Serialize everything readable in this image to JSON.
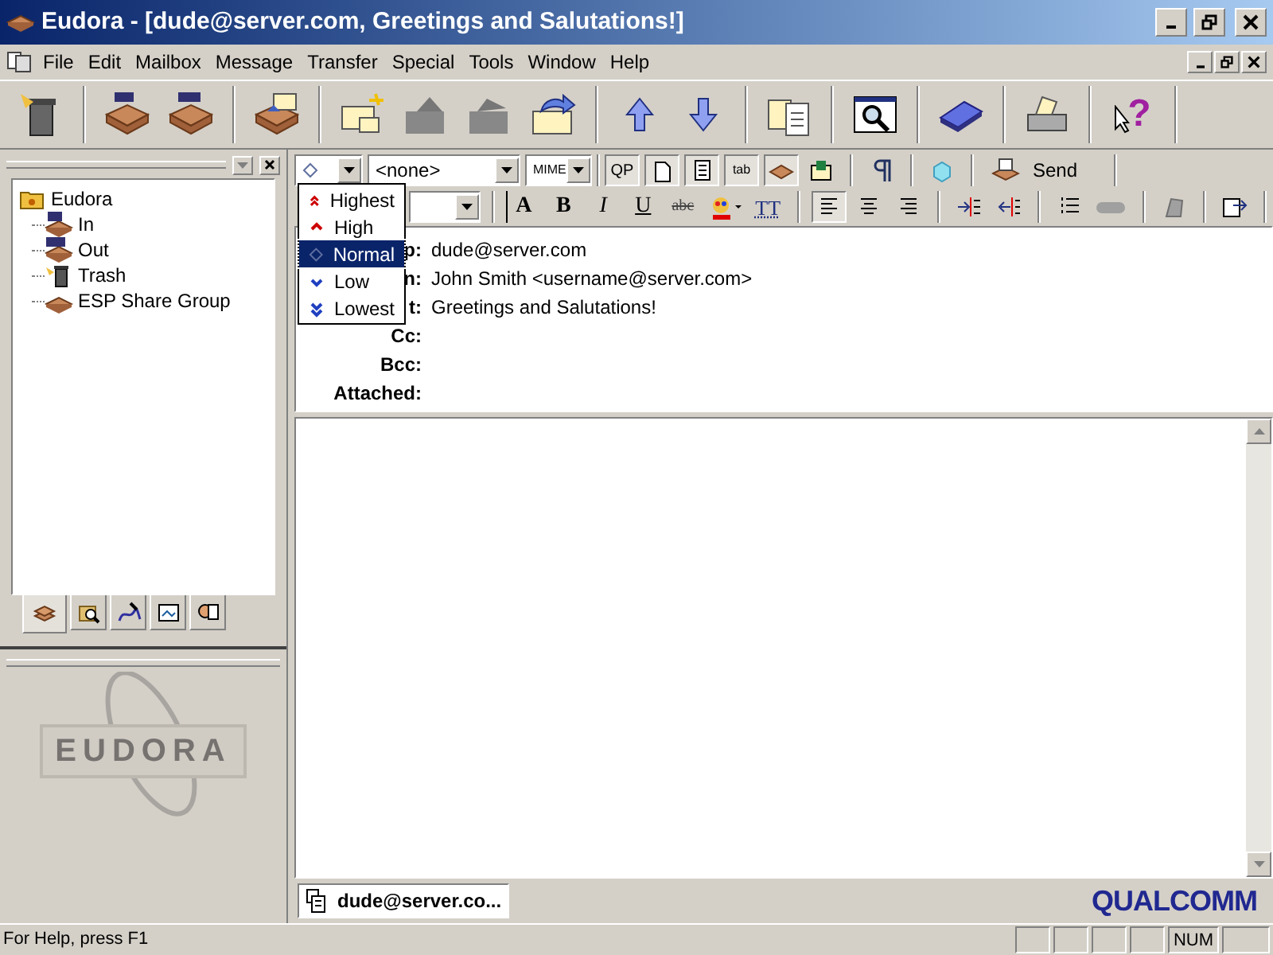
{
  "window": {
    "title": "Eudora - [dude@server.com, Greetings and Salutations!]"
  },
  "menu": [
    "File",
    "Edit",
    "Mailbox",
    "Message",
    "Transfer",
    "Special",
    "Tools",
    "Window",
    "Help"
  ],
  "mailboxes": {
    "label": "Eudora",
    "expanded": true,
    "children": [
      {
        "label": "In",
        "kind": "in"
      },
      {
        "label": "Out",
        "kind": "out"
      },
      {
        "label": "Trash",
        "kind": "trash"
      },
      {
        "label": "ESP Share Group",
        "kind": "box"
      }
    ]
  },
  "panel_tabs": [
    {
      "kind": "mailboxes",
      "selected": true
    },
    {
      "kind": "find",
      "selected": false
    },
    {
      "kind": "signatures",
      "selected": false
    },
    {
      "kind": "stationery",
      "selected": false
    },
    {
      "kind": "people",
      "selected": false
    }
  ],
  "logo_text": "EUDORA",
  "help_glyph": "?",
  "format_buttons": [
    {
      "label": "A",
      "kind": "size"
    },
    {
      "label": "B",
      "kind": "bold"
    },
    {
      "label": "I",
      "kind": "italic"
    },
    {
      "label": "U",
      "kind": "underline"
    },
    {
      "label": "abc",
      "kind": "strike"
    }
  ],
  "text_size_label": "TT",
  "compose": {
    "signature": "<none>",
    "encoding": "MIME",
    "qp_label": "QP",
    "tab_label": "tab",
    "send_label": "Send",
    "priority_menu": [
      {
        "label": "Highest",
        "kind": "highest",
        "selected": false
      },
      {
        "label": "High",
        "kind": "high",
        "selected": false
      },
      {
        "label": "Normal",
        "kind": "normal",
        "selected": true
      },
      {
        "label": "Low",
        "kind": "low",
        "selected": false
      },
      {
        "label": "Lowest",
        "kind": "lowest",
        "selected": false
      }
    ],
    "headers": [
      {
        "label": "p:",
        "value": "dude@server.com"
      },
      {
        "label": "n:",
        "value": "John Smith <username@server.com>"
      },
      {
        "label": "t:",
        "value": "Greetings and Salutations!"
      },
      {
        "label": "Cc:"
      },
      {
        "label": "Bcc:"
      },
      {
        "label": "Attached:"
      }
    ]
  },
  "task_button": "dude@server.co...",
  "brand": "QUALCOMM",
  "status_bar": {
    "text": "For Help, press F1",
    "num": "NUM"
  }
}
